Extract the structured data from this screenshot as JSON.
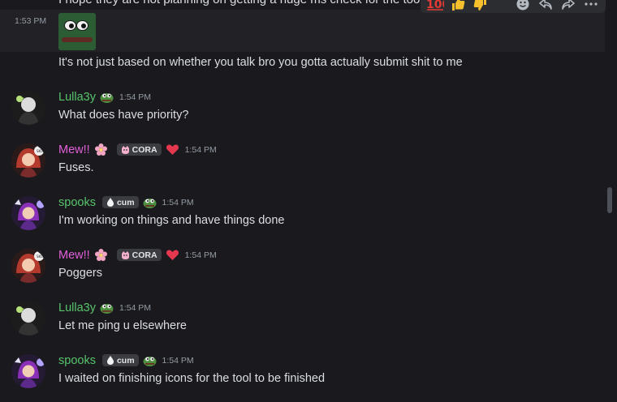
{
  "top_message": {
    "cut_text": "I hope they are not planning on getting a huge ms check for the tool"
  },
  "hover_message": {
    "time": "1:53 PM",
    "text": "It's not just based on whether you talk bro you gotta actually submit shit to me"
  },
  "toolbar": {
    "icons": [
      "100-emoji-icon",
      "thumbs-up-icon",
      "thumbs-down-icon",
      "add-reaction-icon",
      "reply-icon",
      "forward-icon",
      "more-icon"
    ]
  },
  "messages": [
    {
      "username": "Lulla3y",
      "color": "#57c46b",
      "time": "1:54 PM",
      "text": "What does have priority?",
      "badge": null,
      "heart": false,
      "sticker": "pepe"
    },
    {
      "username": "Mew!!",
      "color": "#e35fd9",
      "time": "1:54 PM",
      "text": "Fuses.",
      "badge": "CORA",
      "heart": true,
      "sticker": "flower"
    },
    {
      "username": "spooks",
      "color": "#57c46b",
      "time": "1:54 PM",
      "text": "I'm working on things and have things done",
      "badge": "cum",
      "heart": false,
      "sticker": "pepe"
    },
    {
      "username": "Mew!!",
      "color": "#e35fd9",
      "time": "1:54 PM",
      "text": "Poggers",
      "badge": "CORA",
      "heart": true,
      "sticker": "flower"
    },
    {
      "username": "Lulla3y",
      "color": "#57c46b",
      "time": "1:54 PM",
      "text": "Let me ping u elsewhere",
      "badge": null,
      "heart": false,
      "sticker": "pepe"
    },
    {
      "username": "spooks",
      "color": "#57c46b",
      "time": "1:54 PM",
      "text": "I waited on finishing icons for the tool to be finished",
      "badge": "cum",
      "heart": false,
      "sticker": "pepe"
    }
  ]
}
